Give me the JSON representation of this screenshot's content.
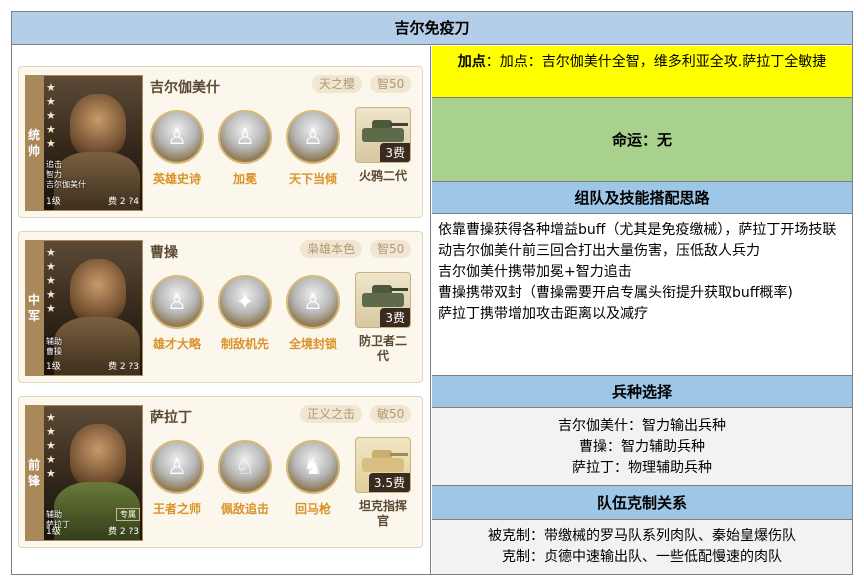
{
  "title": "吉尔免疫刀",
  "generals": [
    {
      "position": "统帅",
      "name": "吉尔伽美什",
      "faction_badge": "天之樱",
      "stat_badge": "智50",
      "meta1": "追击",
      "meta2": "智力",
      "meta3": "吉尔伽美什",
      "level": "1级",
      "cost": "费 2",
      "cost_tail": "4",
      "tag": "",
      "skills": [
        "英雄史诗",
        "加冕",
        "天下当倾"
      ],
      "tank": {
        "name": "火鸦二代",
        "cost": "3费"
      }
    },
    {
      "position": "中军",
      "name": "曹操",
      "faction_badge": "枭雄本色",
      "stat_badge": "智50",
      "meta1": "辅助",
      "meta2": "曹操",
      "meta3": "",
      "level": "1级",
      "cost": "费 2",
      "cost_tail": "3",
      "tag": "",
      "skills": [
        "雄才大略",
        "制敌机先",
        "全境封锁"
      ],
      "tank": {
        "name": "防卫者二代",
        "cost": "3费"
      }
    },
    {
      "position": "前锋",
      "name": "萨拉丁",
      "faction_badge": "正义之击",
      "stat_badge": "敏50",
      "meta1": "辅助",
      "meta2": "萨拉丁",
      "meta3": "",
      "level": "1级",
      "cost": "费 2",
      "cost_tail": "3",
      "tag": "专属",
      "skills": [
        "王者之师",
        "佩敌追击",
        "回马枪"
      ],
      "tank": {
        "name": "坦克指挥官",
        "cost": "3.5费"
      }
    }
  ],
  "right": {
    "points_label": "加点",
    "points_text": "：加点：吉尔伽美什全智，维多利亚全攻.萨拉丁全敏捷",
    "fate": "命运：无",
    "team_header": "组队及技能搭配思路",
    "team_lines": [
      "依靠曹操获得各种增益buff（尤其是免疫缴械），萨拉丁开场技联动吉尔伽美什前三回合打出大量伤害，压低敌人兵力",
      "吉尔伽美什携带加冕+智力追击",
      "曹操携带双封（曹操需要开启专属头衔提升获取buff概率)",
      "萨拉丁携带增加攻击距离以及减疗"
    ],
    "troop_header": "兵种选择",
    "troop_lines": [
      "吉尔伽美什：智力输出兵种",
      "曹操：智力辅助兵种",
      "萨拉丁：物理辅助兵种"
    ],
    "counter_header": "队伍克制关系",
    "counter_lines": [
      "被克制：带缴械的罗马队系列肉队、秦始皇爆伤队",
      "克制：贞德中速输出队、一些低配慢速的肉队"
    ]
  },
  "colors": {
    "title_bg": "#b4cde9",
    "points_bg": "#ffff00",
    "fate_bg": "#a9d18e",
    "header_bg": "#9ec6e7",
    "skill_label": "#d9932a"
  }
}
